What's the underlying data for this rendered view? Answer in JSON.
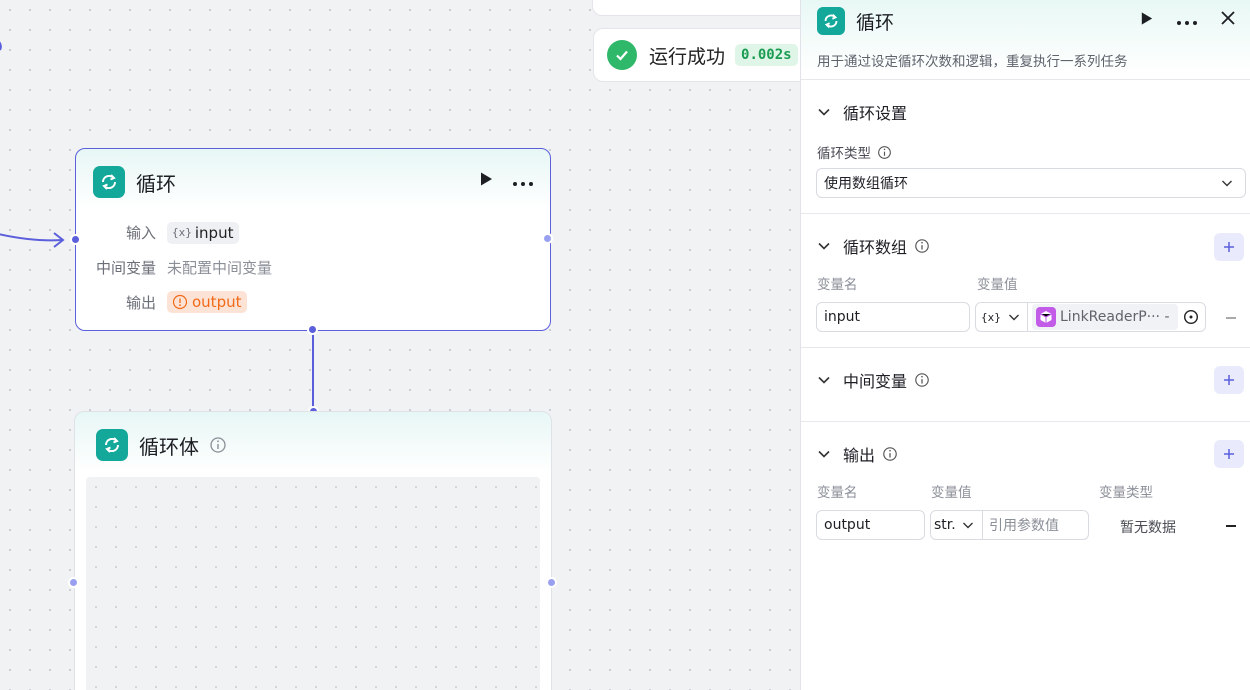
{
  "run_status": {
    "text": "运行成功",
    "time": "0.002s"
  },
  "loop_node": {
    "title": "循环",
    "rows": [
      {
        "label": "输入",
        "value": "input",
        "value_icon": "{x}"
      },
      {
        "label": "中间变量",
        "value": "未配置中间变量"
      },
      {
        "label": "输出",
        "value": "output"
      }
    ]
  },
  "loop_body": {
    "title": "循环体"
  },
  "panel": {
    "title": "循环",
    "description": "用于通过设定循环次数和逻辑，重复执行一系列任务",
    "loop_settings": {
      "title": "循环设置",
      "type_label": "循环类型",
      "type_value": "使用数组循环"
    },
    "loop_array": {
      "title": "循环数组",
      "col_name": "变量名",
      "col_value": "变量值",
      "var_name": "input",
      "ref_type_icon": "{x}",
      "ref_value": "LinkReaderP··· -"
    },
    "intermediate": {
      "title": "中间变量"
    },
    "output": {
      "title": "输出",
      "col_name": "变量名",
      "col_value": "变量值",
      "col_type": "变量类型",
      "var_name": "output",
      "type_value": "str.",
      "value_placeholder": "引用参数值",
      "type_empty": "暂无数据"
    }
  },
  "colors": {
    "accent": "#5b5fdc",
    "loop_icon": "#13a89a",
    "success": "#2fb86a"
  }
}
